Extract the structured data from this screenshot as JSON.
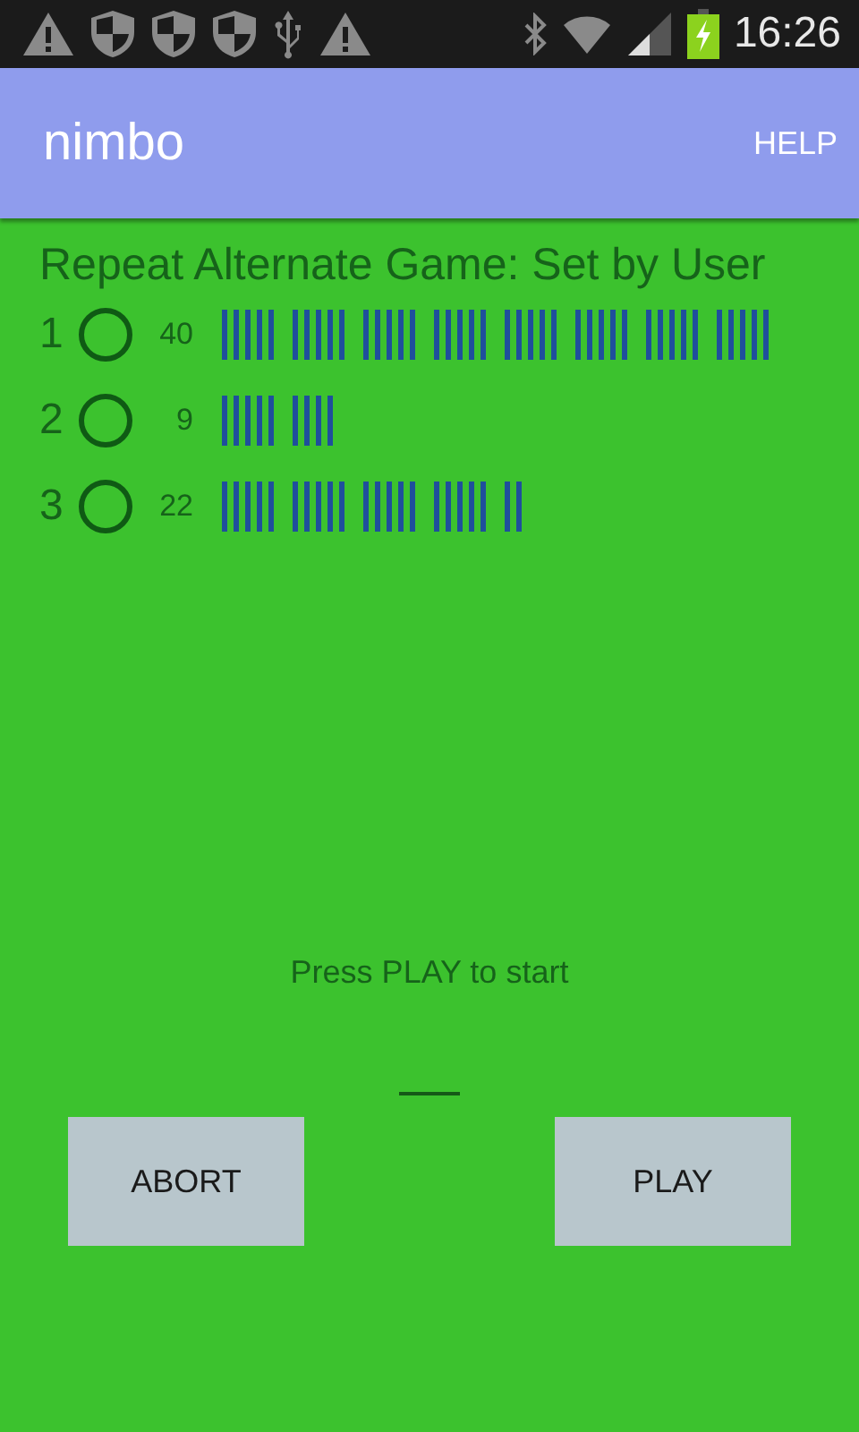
{
  "status_bar": {
    "time": "16:26"
  },
  "app_bar": {
    "title": "nimbo",
    "action": "HELP"
  },
  "heading": "Repeat Alternate Game:  Set by User",
  "piles": [
    {
      "number": "1",
      "selected": false,
      "count": "40"
    },
    {
      "number": "2",
      "selected": false,
      "count": "9"
    },
    {
      "number": "3",
      "selected": false,
      "count": "22"
    }
  ],
  "message": "Press PLAY to start",
  "buttons": [
    {
      "label": "ABORT"
    },
    {
      "label": "PLAY"
    }
  ]
}
